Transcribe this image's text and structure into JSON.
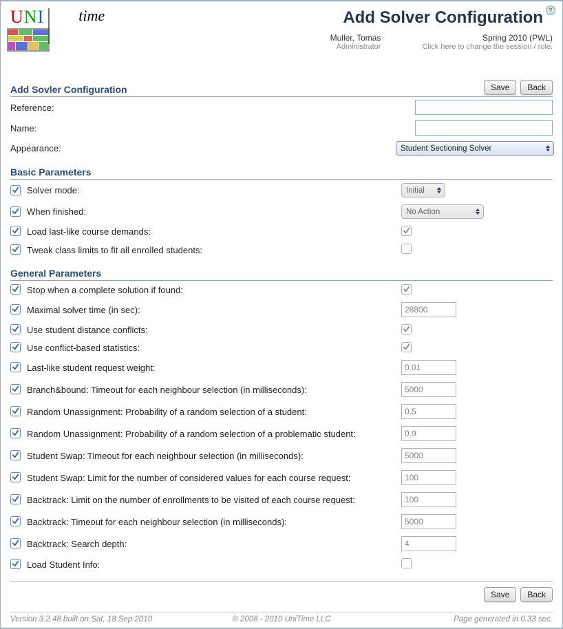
{
  "header": {
    "page_title": "Add Solver Configuration",
    "user_name": "Muller, Tomas",
    "user_role": "Administrator",
    "session_name": "Spring 2010 (PWL)",
    "session_hint": "Click here to change the session / role."
  },
  "section_title": "Add Sovler Configuration",
  "buttons": {
    "save": "Save",
    "back": "Back"
  },
  "form": {
    "reference_label": "Reference:",
    "reference_value": "",
    "name_label": "Name:",
    "name_value": "",
    "appearance_label": "Appearance:",
    "appearance_value": "Student Sectioning Solver"
  },
  "basic": {
    "heading": "Basic Parameters",
    "params": [
      {
        "include": true,
        "label": "Solver mode:",
        "control": "select",
        "value": "Initial"
      },
      {
        "include": true,
        "label": "When finished:",
        "control": "select",
        "value": "No Action"
      },
      {
        "include": true,
        "label": "Load last-like course demands:",
        "control": "check",
        "value": true
      },
      {
        "include": true,
        "label": "Tweak class limits to fit all enrolled students:",
        "control": "check",
        "value": false
      }
    ]
  },
  "general": {
    "heading": "General Parameters",
    "params": [
      {
        "include": true,
        "label": "Stop when a complete solution if found:",
        "control": "check",
        "value": true
      },
      {
        "include": true,
        "label": "Maximal solver time (in sec):",
        "control": "text",
        "value": "28800"
      },
      {
        "include": true,
        "label": "Use student distance conflicts:",
        "control": "check",
        "value": true
      },
      {
        "include": true,
        "label": "Use conflict-based statistics:",
        "control": "check",
        "value": true
      },
      {
        "include": true,
        "label": "Last-like student request weight:",
        "control": "text",
        "value": "0.01"
      },
      {
        "include": true,
        "label": "Branch&bound: Timeout for each neighbour selection (in milliseconds):",
        "control": "text",
        "value": "5000"
      },
      {
        "include": true,
        "label": "Random Unassignment: Probability of a random selection of a student:",
        "control": "text",
        "value": "0.5"
      },
      {
        "include": true,
        "label": "Random Unassignment: Probability of a random selection of a problematic student:",
        "control": "text",
        "value": "0.9"
      },
      {
        "include": true,
        "label": "Student Swap: Timeout for each neighbour selection (in milliseconds):",
        "control": "text",
        "value": "5000"
      },
      {
        "include": true,
        "label": "Student Swap: Limit for the number of considered values for each course request:",
        "control": "text",
        "value": "100"
      },
      {
        "include": true,
        "label": "Backtrack: Limit on the number of enrollments to be visited of each course request:",
        "control": "text",
        "value": "100"
      },
      {
        "include": true,
        "label": "Backtrack: Timeout for each neighbour selection (in milliseconds):",
        "control": "text",
        "value": "5000"
      },
      {
        "include": true,
        "label": "Backtrack: Search depth:",
        "control": "text",
        "value": "4"
      },
      {
        "include": true,
        "label": "Load Student Info:",
        "control": "check",
        "value": false
      }
    ]
  },
  "footer": {
    "version": "Version 3.2.48 built on Sat, 18 Sep 2010",
    "copyright": "© 2008 - 2010 UniTime LLC",
    "timing": "Page generated in 0.33 sec."
  }
}
